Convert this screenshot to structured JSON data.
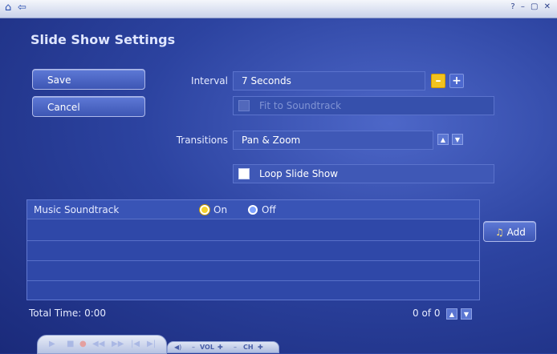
{
  "window": {
    "home_glyph": "⌂",
    "back_glyph": "⇦",
    "controls": "? – ▢ ✕"
  },
  "page": {
    "title": "Slide Show Settings"
  },
  "buttons": {
    "save": "Save",
    "cancel": "Cancel",
    "add": "Add",
    "add_icon": "♫"
  },
  "settings": {
    "interval_label": "Interval",
    "interval_value": "7 Seconds",
    "minus": "–",
    "plus": "+",
    "fit_label": "Fit to Soundtrack",
    "transitions_label": "Transitions",
    "transitions_value": "Pan & Zoom",
    "loop_label": "Loop Slide Show"
  },
  "music": {
    "label": "Music Soundtrack",
    "on_label": "On",
    "off_label": "Off",
    "total_time": "Total Time: 0:00",
    "count": "0 of 0"
  },
  "transport": {
    "vol_label": "VOL",
    "ch_label": "CH"
  },
  "colors": {
    "accent": "#f2c21e",
    "background": "#2c43a0"
  }
}
